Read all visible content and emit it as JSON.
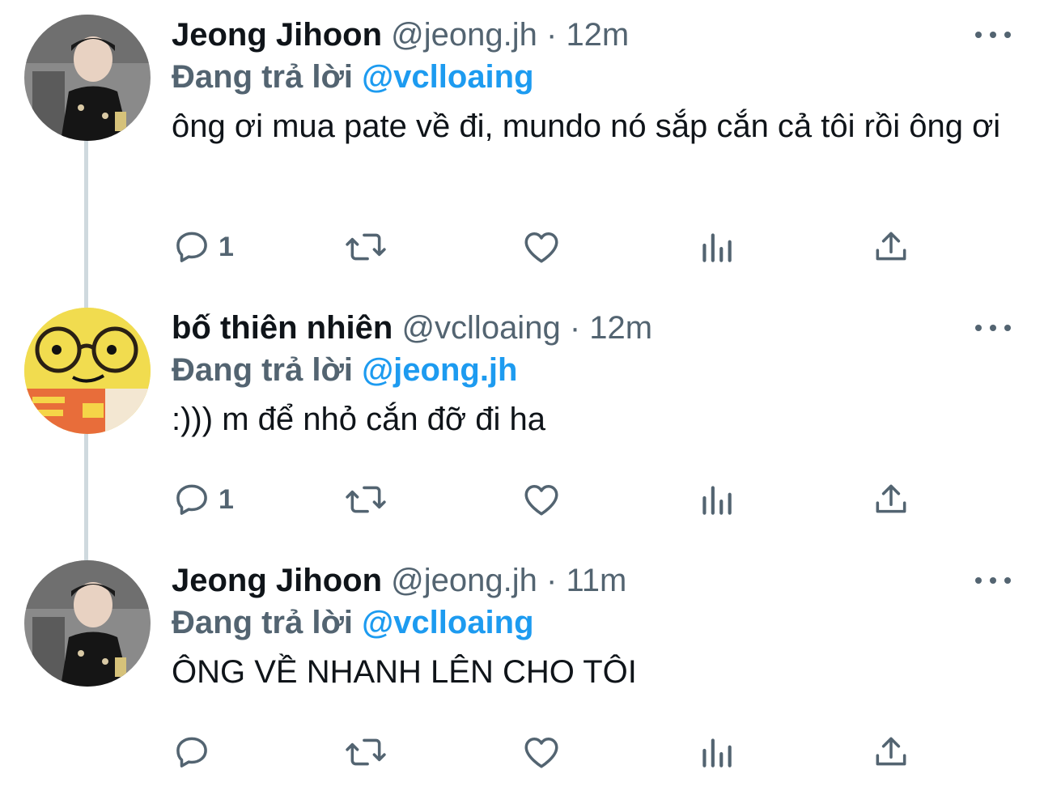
{
  "colors": {
    "name": "#0f1419",
    "muted": "#536471",
    "link": "#1d9bf0",
    "thread_line": "#cfd9de"
  },
  "tweets": [
    {
      "name": "Jeong Jihoon",
      "handle": "@jeong.jh",
      "separator": "·",
      "time": "12m",
      "reply_prefix": "Đang trả lời",
      "reply_to": "@vclloaing",
      "text": "ông ơi mua pate về đi, mundo nó sắp cắn cả tôi rồi ông ơi",
      "reply_count": "1",
      "avatar_icon": "profile-photo-person-icon"
    },
    {
      "name": "bố thiên nhiên",
      "handle": "@vclloaing",
      "separator": "·",
      "time": "12m",
      "reply_prefix": "Đang trả lời",
      "reply_to": "@jeong.jh",
      "text": ":))) m để nhỏ cắn đỡ đi ha",
      "reply_count": "1",
      "avatar_icon": "profile-photo-plush-glasses-icon"
    },
    {
      "name": "Jeong Jihoon",
      "handle": "@jeong.jh",
      "separator": "·",
      "time": "11m",
      "reply_prefix": "Đang trả lời",
      "reply_to": "@vclloaing",
      "text": "ÔNG VỀ NHANH LÊN CHO TÔI",
      "reply_count": "",
      "avatar_icon": "profile-photo-person-icon"
    }
  ],
  "action_icons": [
    "reply-icon",
    "retweet-icon",
    "like-icon",
    "views-icon",
    "share-icon"
  ]
}
